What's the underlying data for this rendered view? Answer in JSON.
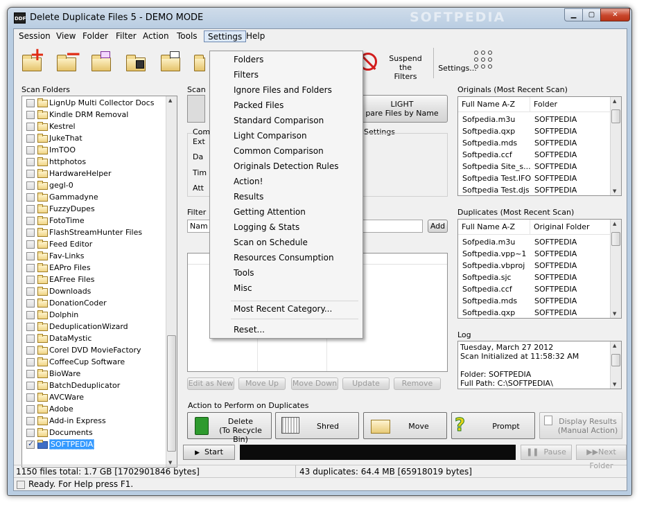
{
  "window": {
    "title": "Delete Duplicate Files 5 - DEMO MODE",
    "watermark": "SOFTPEDIA",
    "app_icon": "DDF"
  },
  "menubar": [
    "Session",
    "View",
    "Folder",
    "Filter",
    "Action",
    "Tools",
    "Settings",
    "Help"
  ],
  "toolbar": {
    "suspend_filters": [
      "Suspend",
      "the",
      "Filters"
    ],
    "settings_label": "Settings...",
    "icons": [
      "add-folder-icon",
      "remove-folder-icon",
      "folder-doc-icon",
      "folder-save-icon",
      "folder-list-icon",
      "folder-tool-icon",
      "no-filter-icon",
      "settings-dots-icon"
    ]
  },
  "scan_folders": {
    "label": "Scan Folders",
    "items": [
      {
        "name": "LignUp Multi Collector Docs",
        "checked": false
      },
      {
        "name": "Kindle DRM Removal",
        "checked": false
      },
      {
        "name": "Kestrel",
        "checked": false
      },
      {
        "name": "JukeThat",
        "checked": false
      },
      {
        "name": "ImTOO",
        "checked": false
      },
      {
        "name": "httphotos",
        "checked": false
      },
      {
        "name": "HardwareHelper",
        "checked": false
      },
      {
        "name": "gegl-0",
        "checked": false
      },
      {
        "name": "Gammadyne",
        "checked": false
      },
      {
        "name": "FuzzyDupes",
        "checked": false
      },
      {
        "name": "FotoTime",
        "checked": false
      },
      {
        "name": "FlashStreamHunter Files",
        "checked": false
      },
      {
        "name": "Feed Editor",
        "checked": false
      },
      {
        "name": "Fav-Links",
        "checked": false
      },
      {
        "name": "EAPro Files",
        "checked": false
      },
      {
        "name": "EAFree Files",
        "checked": false
      },
      {
        "name": "Downloads",
        "checked": false
      },
      {
        "name": "DonationCoder",
        "checked": false
      },
      {
        "name": "Dolphin",
        "checked": false
      },
      {
        "name": "DeduplicationWizard",
        "checked": false
      },
      {
        "name": "DataMystic",
        "checked": false
      },
      {
        "name": "Corel DVD MovieFactory",
        "checked": false
      },
      {
        "name": "CoffeeCup Software",
        "checked": false
      },
      {
        "name": "BioWare",
        "checked": false
      },
      {
        "name": "BatchDeduplicator",
        "checked": false
      },
      {
        "name": "AVCWare",
        "checked": false
      },
      {
        "name": "Adobe",
        "checked": false
      },
      {
        "name": "Add-in Express",
        "checked": false
      },
      {
        "name": "Documents",
        "checked": false
      },
      {
        "name": "SOFTPEDIA",
        "checked": true,
        "selected": true
      }
    ]
  },
  "middle": {
    "scan_label": "Scan",
    "light_button": [
      "LIGHT",
      "pare Files by Name"
    ],
    "settings_label": "Settings",
    "info_labels": [
      "Com",
      "Ext",
      "Da",
      "Tim",
      "Att"
    ],
    "filter_label": "Filter",
    "filter_field": "Nam",
    "add_button": "Add",
    "filter_buttons": [
      "Edit as New",
      "Move Up",
      "Move Down",
      "Update",
      "Remove"
    ]
  },
  "originals": {
    "label": "Originals (Most Recent Scan)",
    "columns": [
      "Full Name A-Z",
      "Folder"
    ],
    "rows": [
      [
        "Sofpedia.m3u",
        "SOFTPEDIA"
      ],
      [
        "Softpedia.qxp",
        "SOFTPEDIA"
      ],
      [
        "Softpedia.mds",
        "SOFTPEDIA"
      ],
      [
        "Softpedia.ccf",
        "SOFTPEDIA"
      ],
      [
        "Softpedia Site_s...",
        "SOFTPEDIA"
      ],
      [
        "Softpedia Test.IFO",
        "SOFTPEDIA"
      ],
      [
        "Softpedia Test.djs",
        "SOFTPEDIA"
      ]
    ]
  },
  "duplicates": {
    "label": "Duplicates (Most Recent Scan)",
    "columns": [
      "Full Name A-Z",
      "Original Folder"
    ],
    "rows": [
      [
        "Sofpedia.m3u",
        "SOFTPEDIA"
      ],
      [
        "Softpedia.vpp~1",
        "SOFTPEDIA"
      ],
      [
        "Softpedia.vbproj",
        "SOFTPEDIA"
      ],
      [
        "Softpedia.sjc",
        "SOFTPEDIA"
      ],
      [
        "Softpedia.ccf",
        "SOFTPEDIA"
      ],
      [
        "Softpedia.mds",
        "SOFTPEDIA"
      ],
      [
        "Softpedia.qxp",
        "SOFTPEDIA"
      ]
    ]
  },
  "log": {
    "label": "Log",
    "lines": [
      "Tuesday, March 27 2012",
      "Scan Initialized at 11:58:32 AM",
      "",
      "Folder: SOFTPEDIA",
      "Full Path: C:\\SOFTPEDIA\\"
    ]
  },
  "actions": {
    "label": "Action to Perform on Duplicates",
    "delete": [
      "Delete",
      "(To Recycle Bin)"
    ],
    "shred": "Shred",
    "move": "Move",
    "prompt": "Prompt",
    "display": [
      "Display Results",
      "(Manual Action)"
    ]
  },
  "run": {
    "start": "Start",
    "pause": "Pause",
    "next_folder": "Next Folder"
  },
  "status": {
    "files_total": "1150 files total: 1.7 GB [1702901846 bytes]",
    "duplicates_total": "43 duplicates: 64.4 MB [65918019 bytes]",
    "ready": "Ready. For Help press F1."
  },
  "settings_menu": {
    "items": [
      "Folders",
      "Filters",
      "Ignore Files and Folders",
      "Packed Files",
      "Standard Comparison",
      "Light Comparison",
      "Common Comparison",
      "Originals Detection Rules",
      "Action!",
      "Results",
      "Getting Attention",
      "Logging & Stats",
      "Scan on Schedule",
      "Resources Consumption",
      "Tools",
      "Misc"
    ],
    "recent": "Most Recent Category...",
    "reset": "Reset..."
  }
}
